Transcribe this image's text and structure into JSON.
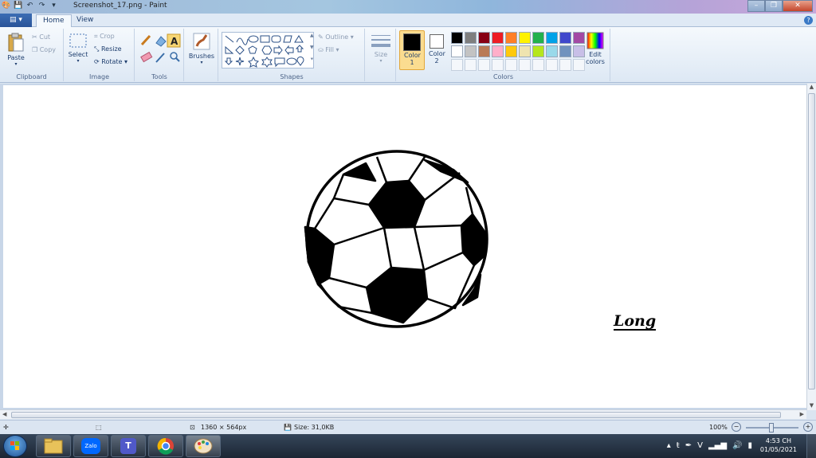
{
  "window": {
    "title": "Screenshot_17.png - Paint",
    "controls": {
      "minimize": "–",
      "maximize": "❐",
      "close": "✕"
    }
  },
  "tabs": {
    "file_icon": "▤ ▾",
    "home": "Home",
    "view": "View",
    "help": "?"
  },
  "ribbon": {
    "clipboard": {
      "label": "Clipboard",
      "paste": "Paste",
      "cut": "Cut",
      "copy": "Copy"
    },
    "image": {
      "label": "Image",
      "select": "Select",
      "crop": "Crop",
      "resize": "Resize",
      "rotate": "Rotate"
    },
    "tools": {
      "label": "Tools"
    },
    "brushes": {
      "label": "Brushes"
    },
    "shapes": {
      "label": "Shapes",
      "outline": "Outline",
      "fill": "Fill"
    },
    "size": {
      "label": "Size"
    },
    "colors": {
      "label": "Colors",
      "color1": "Color 1",
      "color2": "Color 2",
      "edit": "Edit colors",
      "color1_value": "#000000",
      "color2_value": "#ffffff",
      "palette_row1": [
        "#000000",
        "#7f7f7f",
        "#880015",
        "#ed1c24",
        "#ff7f27",
        "#fff200",
        "#22b14c",
        "#00a2e8",
        "#3f48cc",
        "#a349a4"
      ],
      "palette_row2": [
        "#ffffff",
        "#c3c3c3",
        "#b97a57",
        "#ffaec9",
        "#ffc90e",
        "#efe4b0",
        "#b5e61d",
        "#99d9ea",
        "#7092be",
        "#c8bfe7"
      ]
    }
  },
  "canvas": {
    "signature": "Long"
  },
  "status": {
    "dimensions": "1360 × 564px",
    "size": "Size: 31,0KB",
    "zoom": "100%"
  },
  "taskbar": {
    "apps": [
      "windows-start",
      "file-explorer",
      "zalo",
      "teams",
      "chrome",
      "paint"
    ],
    "zalo_label": "Zalo",
    "time": "4:53 CH",
    "date": "01/05/2021"
  }
}
